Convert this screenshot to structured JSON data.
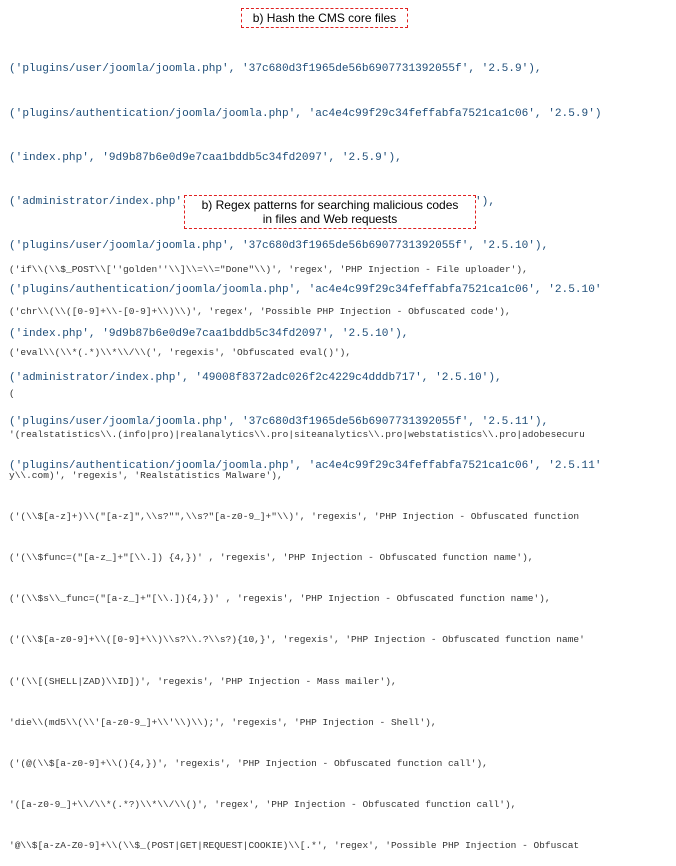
{
  "section_a": {
    "caption": "b) Hash the CMS core files",
    "lines": [
      "('plugins/user/joomla/joomla.php', '37c680d3f1965de56b6907731392055f', '2.5.9'),",
      "('plugins/authentication/joomla/joomla.php', 'ac4e4c99f29c34feffabfa7521ca1c06', '2.5.9')",
      "('index.php', '9d9b87b6e0d9e7caa1bddb5c34fd2097', '2.5.9'),",
      "('administrator/index.php', '49008f8372adc026f2c4229c4dddb717', '2.5.9'),",
      "('plugins/user/joomla/joomla.php', '37c680d3f1965de56b6907731392055f', '2.5.10'),",
      "('plugins/authentication/joomla/joomla.php', 'ac4e4c99f29c34feffabfa7521ca1c06', '2.5.10'",
      "('index.php', '9d9b87b6e0d9e7caa1bddb5c34fd2097', '2.5.10'),",
      "('administrator/index.php', '49008f8372adc026f2c4229c4dddb717', '2.5.10'),",
      "('plugins/user/joomla/joomla.php', '37c680d3f1965de56b6907731392055f', '2.5.11'),",
      "('plugins/authentication/joomla/joomla.php', 'ac4e4c99f29c34feffabfa7521ca1c06', '2.5.11'"
    ]
  },
  "section_b": {
    "caption_line1": "b) Regex patterns for searching malicious codes",
    "caption_line2": "in files and Web requests",
    "lines": [
      "('if\\\\(\\\\$_POST\\\\[''golden''\\\\]\\\\=\\\\=\"Done\"\\\\)', 'regex', 'PHP Injection - File uploader'),",
      "('chr\\\\(\\\\([0-9]+\\\\-[0-9]+\\\\)\\\\)', 'regex', 'Possible PHP Injection - Obfuscated code'),",
      "('eval\\\\(\\\\*(.*)\\\\*\\\\/\\\\(', 'regexis', 'Obfuscated eval()'),",
      "(",
      "'(realstatistics\\\\.(info|pro)|realanalytics\\\\.pro|siteanalytics\\\\.pro|webstatistics\\\\.pro|adobesecuru",
      "y\\\\.com)', 'regexis', 'Realstatistics Malware'),",
      "('(\\\\$[a-z]+)\\\\(\"[a-z]\",\\\\s?\"\",\\\\s?\"[a-z0-9_]+\"\\\\)', 'regexis', 'PHP Injection - Obfuscated function",
      "('(\\\\$func=(\"[a-z_]+\"[\\\\.]) {4,})' , 'regexis', 'PHP Injection - Obfuscated function name'),",
      "('(\\\\$s\\\\_func=(\"[a-z_]+\"[\\\\.]){4,})' , 'regexis', 'PHP Injection - Obfuscated function name'),",
      "('(\\\\$[a-z0-9]+\\\\([0-9]+\\\\)\\\\s?\\\\.?\\\\s?){10,}', 'regexis', 'PHP Injection - Obfuscated function name'",
      "('(\\\\[(SHELL|ZAD)\\\\ID])', 'regexis', 'PHP Injection - Mass mailer'),",
      "'die\\\\(md5\\\\(\\\\'[a-z0-9_]+\\\\'\\\\)\\\\);', 'regexis', 'PHP Injection - Shell'),",
      "('(@(\\\\$[a-z0-9]+\\\\(){4,})', 'regexis', 'PHP Injection - Obfuscated function call'),",
      "'([a-z0-9_]+\\\\/\\\\*(.*?)\\\\*\\\\/\\\\()', 'regex', 'PHP Injection - Obfuscated function call'),",
      "'@\\\\$[a-zA-Z0-9]+\\\\(\\\\$_(POST|GET|REQUEST|COOKIE)\\\\[.*', 'regex', 'Possible PHP Injection - Obfuscat"
    ]
  }
}
